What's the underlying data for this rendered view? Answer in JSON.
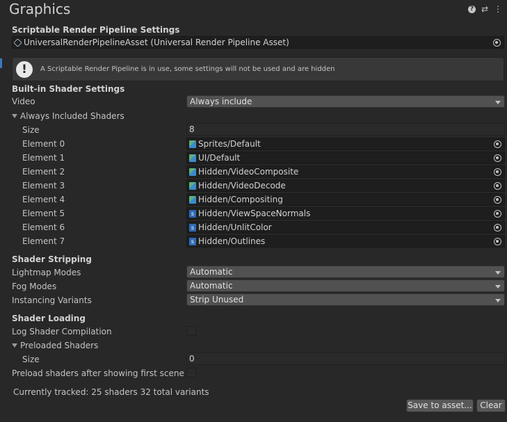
{
  "window": {
    "title": "Graphics"
  },
  "header_icons": [
    "help-icon",
    "preset-sliders-icon",
    "more-vertical-icon"
  ],
  "srp": {
    "section": "Scriptable Render Pipeline Settings",
    "asset": "UniversalRenderPipelineAsset (Universal Render Pipeline Asset)",
    "help": "A Scriptable Render Pipeline is in use, some settings will not be used and are hidden"
  },
  "builtin": {
    "section": "Built-in Shader Settings",
    "video_label": "Video",
    "video_value": "Always include",
    "always_included_label": "Always Included Shaders",
    "size_label": "Size",
    "size_value": "8",
    "elements": [
      {
        "label": "Element 0",
        "value": "Sprites/Default",
        "icon": "shadergraph-icon"
      },
      {
        "label": "Element 1",
        "value": "UI/Default",
        "icon": "shadergraph-icon"
      },
      {
        "label": "Element 2",
        "value": "Hidden/VideoComposite",
        "icon": "shadergraph-icon"
      },
      {
        "label": "Element 3",
        "value": "Hidden/VideoDecode",
        "icon": "shadergraph-icon"
      },
      {
        "label": "Element 4",
        "value": "Hidden/Compositing",
        "icon": "shadergraph-icon"
      },
      {
        "label": "Element 5",
        "value": "Hidden/ViewSpaceNormals",
        "icon": "shader-code-icon"
      },
      {
        "label": "Element 6",
        "value": "Hidden/UnlitColor",
        "icon": "shader-code-icon"
      },
      {
        "label": "Element 7",
        "value": "Hidden/Outlines",
        "icon": "shader-code-icon"
      }
    ]
  },
  "stripping": {
    "section": "Shader Stripping",
    "lightmap_label": "Lightmap Modes",
    "lightmap_value": "Automatic",
    "fog_label": "Fog Modes",
    "fog_value": "Automatic",
    "instancing_label": "Instancing Variants",
    "instancing_value": "Strip Unused"
  },
  "loading": {
    "section": "Shader Loading",
    "log_label": "Log Shader Compilation",
    "log_checked": false,
    "preloaded_label": "Preloaded Shaders",
    "size_label": "Size",
    "size_value": "0",
    "preload_after_label": "Preload shaders after showing first scene",
    "preload_after_checked": false
  },
  "footer": {
    "tracked": "Currently tracked: 25 shaders 32 total variants",
    "save_label": "Save to asset...",
    "clear_label": "Clear"
  }
}
